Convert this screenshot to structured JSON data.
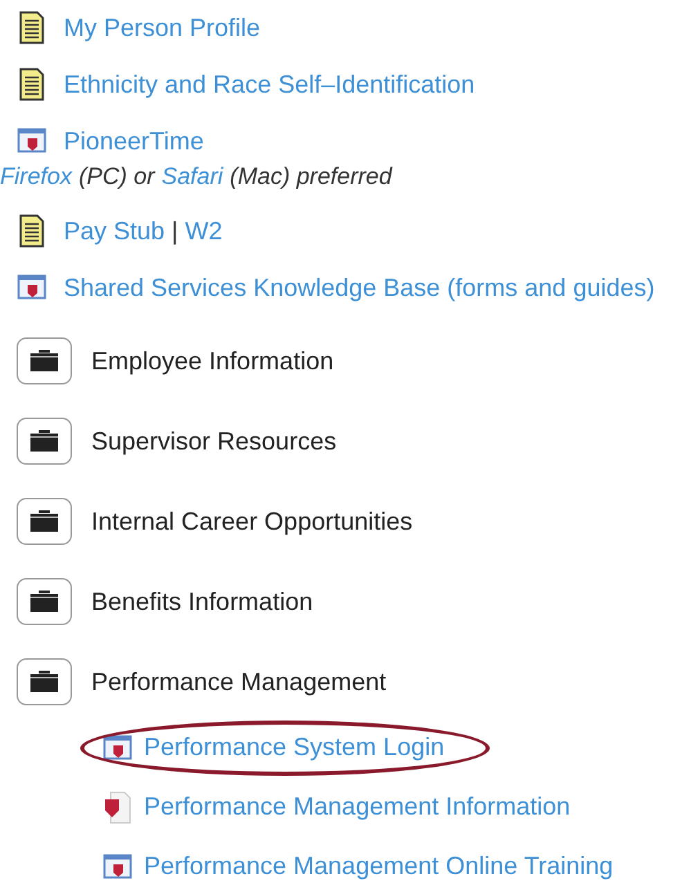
{
  "top_links": [
    {
      "kind": "document",
      "labels": [
        "My Person Profile"
      ]
    },
    {
      "kind": "document",
      "labels": [
        "Ethnicity and Race Self–Identification"
      ]
    },
    {
      "kind": "web",
      "labels": [
        "PioneerTime"
      ],
      "note": [
        {
          "text": "Firefox",
          "link": true
        },
        {
          "text": "(PC) or",
          "link": false
        },
        {
          "text": "Safari",
          "link": true
        },
        {
          "text": "(Mac) preferred",
          "link": false
        }
      ]
    },
    {
      "kind": "document",
      "labels": [
        "Pay Stub",
        "W2"
      ],
      "separator": "|"
    },
    {
      "kind": "web",
      "labels": [
        "Shared Services Knowledge Base (forms and guides)"
      ]
    }
  ],
  "folders": [
    {
      "label": "Employee Information"
    },
    {
      "label": "Supervisor Resources"
    },
    {
      "label": "Internal Career Opportunities"
    },
    {
      "label": "Benefits Information"
    },
    {
      "label": "Performance Management",
      "children": [
        {
          "kind": "web",
          "label": "Performance System Login",
          "circled": true
        },
        {
          "kind": "file",
          "label": "Performance Management Information",
          "circled": false
        },
        {
          "kind": "web",
          "label": "Performance Management Online Training",
          "circled": false
        }
      ]
    }
  ]
}
